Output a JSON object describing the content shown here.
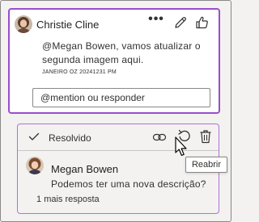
{
  "thread1": {
    "author": "Christie Cline",
    "more_glyph": "•••",
    "text": "@Megan Bowen, vamos atualizar o segunda imagem aqui.",
    "date": "JANEIRO OZ 20241231 PM",
    "reply_placeholder": "@mention ou responder"
  },
  "thread2": {
    "status": "Resolvido",
    "author": "Megan Bowen",
    "text": "Podemos ter uma nova descrição?",
    "more_replies_count": "1",
    "more_replies_text": "mais resposta"
  },
  "tooltip": "Reabrir",
  "icons": {
    "more": "more-icon",
    "edit": "pencil-icon",
    "like": "thumbs-up-icon",
    "resolved": "check-icon",
    "link": "link-icon",
    "reopen": "reopen-icon",
    "delete": "trash-icon"
  },
  "colors": {
    "active_border": "#9b4dca",
    "resolved_border": "#b070d8",
    "background": "#f3f2f1",
    "card": "#ffffff"
  }
}
